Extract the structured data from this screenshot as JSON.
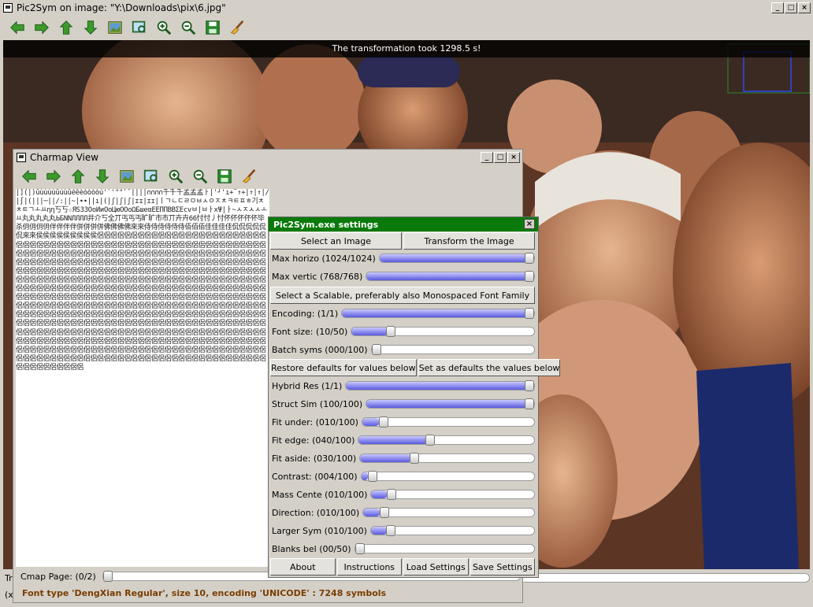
{
  "main_window": {
    "title": "Pic2Sym on image: \"Y:\\Downloads\\pix\\6.jpg\"",
    "controls": {
      "minimize": "_",
      "maximize": "□",
      "close": "×"
    },
    "toolbar_icons": [
      "arrow-left-icon",
      "arrow-right-icon",
      "arrow-up-icon",
      "arrow-down-icon",
      "image-icon",
      "zoom-fit-icon",
      "zoom-in-icon",
      "zoom-out-icon",
      "save-icon",
      "broom-icon"
    ],
    "status_banner": "The transformation took 1298.5 s!",
    "bottom_fragment_1": "Tr",
    "bottom_fragment_2": "(x"
  },
  "charmap_window": {
    "title": "Charmap View",
    "toolbar_icons": [
      "arrow-left-icon",
      "arrow-right-icon",
      "arrow-up-icon",
      "arrow-down-icon",
      "image-icon",
      "zoom-fit-icon",
      "zoom-in-icon",
      "zoom-out-icon",
      "save-icon",
      "broom-icon"
    ],
    "glyphs": "|](|)ūùùùùūúùûéêèòòòòú'`'\"\"ʹˉ||||∩∩∩∩千千千孟孟孟ㅏ|'┘'ı+˜↑+|↑|↑|/|∫|(|||─||/:||~|∙∙||ı|(|ʃ|ʃ|ʃ|ɪɪ|ɪɪ|ㅣㄱㄴㄷㄹㅁㅂㅅㅇㅈㅊㅋㅌㅍㅎ기ㅊㅊㅌㄱㅗㅛηη丂丂☆ЯЅЗЗОоИиОоЦюООоΩБшеαЕЕΠПВВΣЕсvㅂ|ㅂㅏxΨ|ㅏ~ㅅㅈㅅㅅㅗㅛ丸丸丸丸丸ЬБNNЛЛЛЛ井介丂全丌丐丐丐旷旷市市丌卉卉66忖忖丿忖伓伓伓伓伓毕杀仴仴仴仴伴伴伴伴併併併併佛佛佛佛來來侍侍侍侍侍侍佰佰佰佳佳佳佳侃侃侃侃侃侃來來侯侯侯侯侯侯侯侯侯侶侶侶侶侶侶侶侶侶侶侶侶侶侶侶侶侶侶侶侶侶侶侶侶侶侶侶侶侶侶侶侶侶侶侶侶侶侶侶侶侶侶侶侶侶侶侶侶侶侶侶侶侶侶侶侶侶侶侶侶侶侶侶侶侶侶侶侶侶侶侶侶侶侶侶侶侶侶侶侶侶侶侶侶侶侶侶侶侶侶侶侶侶侶侶侶侶侶侶侶侶侶侶侶侶侶侶侶侶侶侶侶侶侶侶侶侶侶侶侶侶侶侶侶侶侶侶侶侶侶侶侶侶侶侶侶侶侶侶侶侶侶侶侶侶侶侶侶侶侶侶侶侶侶侶侶侶侶侶侶侶侶侶侶侶侶侶侶侶侶侶侶侶侶侶侶侶侶侶侶侶侶侶侶侶侶侶侶侶侶侶侶侶侶侶侶侶侶侶侶侶侶侶侶侶侶侶侶侶侶侶侶侶侶侶侶侶侶侶侶侶侶侶侶侶侶侶侶侶侶侶侶侶侶侶侶侶侶侶侶侶侶侶侶侶侶侶侶侶侶侶侶侶侶侶侶侶侶侶侶侶侶侶侶侶侶侶侶侶侶侶侶侶侶侶侶侶侶侶侶侶侶侶侶侶侶侶侶侶侶侶侶侶侶侶侶侶侶侶侶侶侶侶侶侶侶侶侶侶侶侶侶侶侶侶侶侶侶侶侶侶侶侶侶侶侶侶侶侶侶侶侶侶侶侶侶侶侶侶侶侶侶侶侶侶侶侶侶侶侶侶侶侶侶侶侶侶侶侶侶侶侶侶侶侶侶侶侶侶侶侶侶侶侶侶侶侶侶侶侶侶侶侶侶侶侶侶侶侶侶侶侶侶侶侶侶侶侶侶侶侶侶侶侶侶侶侶侶侶侶侶侶侶侶侶侶侶侶侶侶侶侶侶侶侶侶侶侶侶侶侶侶侶侶侶侶侶侶侶侶侶侶侶侶侶侶侶侶侶侶侶侶侶侶侶侶侶侶侶侶侶侶侶侶侶侶侶侶侶侶侶侶侶侶侶侶侶侶侶侶侶侶侶侶侶侶侶侶侶侶侶侶侶侶侶侶侶侶侶侶侶侶侶侶侶侶侶侶侶侶侶侶侶侶侶侶侶侶侶侶侶侶侶侶侶侶侶侶侶侶侶侶侶侶侶侶侶侶侶侶侶侶侶侶侶侶侶侶侶侶侶侶侶",
    "cmap_page_label": "Cmap Page: (0/2)",
    "cmap_page_value": 0,
    "cmap_page_max": 2,
    "font_status": "Font type 'DengXian Regular', size 10, encoding 'UNICODE' : 7248 symbols"
  },
  "settings_window": {
    "title": "Pic2Sym.exe settings",
    "select_image": "Select an Image",
    "transform_image": "Transform the Image",
    "select_font": "Select a Scalable, preferably also Monospaced Font Family",
    "restore_defaults": "Restore defaults for values below",
    "set_defaults": "Set as defaults the values below",
    "about": "About",
    "instructions": "Instructions",
    "load_settings": "Load Settings",
    "save_settings": "Save Settings",
    "sliders_top": [
      {
        "label": "Max horizo (1024/1024)",
        "value": 1024,
        "max": 1024
      },
      {
        "label": "Max vertic (768/768)",
        "value": 768,
        "max": 768
      }
    ],
    "sliders_font": [
      {
        "label": "Encoding:  (1/1)",
        "value": 1,
        "max": 1
      },
      {
        "label": "Font size: (10/50)",
        "value": 10,
        "max": 50
      },
      {
        "label": "Batch syms (000/100)",
        "value": 0,
        "max": 100
      }
    ],
    "sliders_match": [
      {
        "label": "Hybrid Res (1/1)",
        "value": 1,
        "max": 1
      },
      {
        "label": "Struct Sim (100/100)",
        "value": 100,
        "max": 100
      },
      {
        "label": "Fit under: (010/100)",
        "value": 10,
        "max": 100
      },
      {
        "label": "Fit edge:  (040/100)",
        "value": 40,
        "max": 100
      },
      {
        "label": "Fit aside: (030/100)",
        "value": 30,
        "max": 100
      },
      {
        "label": "Contrast:  (004/100)",
        "value": 4,
        "max": 100
      },
      {
        "label": "Mass Cente (010/100)",
        "value": 10,
        "max": 100
      },
      {
        "label": "Direction: (010/100)",
        "value": 10,
        "max": 100
      },
      {
        "label": "Larger Sym (010/100)",
        "value": 10,
        "max": 100
      },
      {
        "label": "Blanks bel (00/50)",
        "value": 0,
        "max": 50
      }
    ]
  },
  "colors": {
    "settings_title": "#0a7a0a",
    "slider_fill": "#5a5adf",
    "font_status": "#7a3d00"
  }
}
